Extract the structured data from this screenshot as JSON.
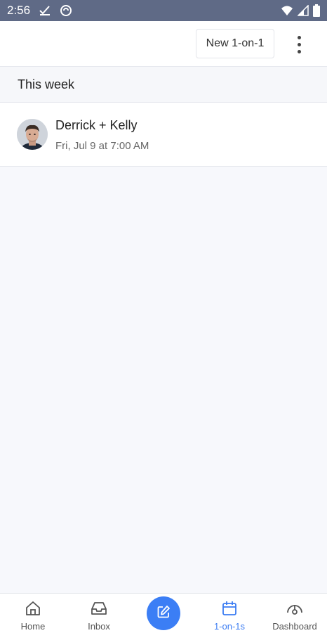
{
  "status_bar": {
    "time": "2:56",
    "icons": [
      "check-notification-icon",
      "sync-icon",
      "wifi-icon",
      "cell-signal-icon",
      "battery-icon"
    ]
  },
  "app_bar": {
    "new_button_label": "New 1-on-1",
    "more_icon": "more-vertical-icon"
  },
  "section": {
    "title": "This week"
  },
  "meetings": [
    {
      "title": "Derrick + Kelly",
      "datetime": "Fri, Jul 9 at 7:00 AM",
      "avatar": "avatar-photo"
    }
  ],
  "bottom_nav": {
    "items": [
      {
        "label": "Home",
        "icon": "home-icon"
      },
      {
        "label": "Inbox",
        "icon": "inbox-icon"
      },
      {
        "label": "",
        "icon": "compose-icon"
      },
      {
        "label": "1-on-1s",
        "icon": "calendar-icon",
        "active": true
      },
      {
        "label": "Dashboard",
        "icon": "dashboard-icon"
      }
    ]
  },
  "colors": {
    "status_bar": "#5f6a86",
    "accent": "#3b7ef5",
    "background": "#f7f8fc"
  }
}
